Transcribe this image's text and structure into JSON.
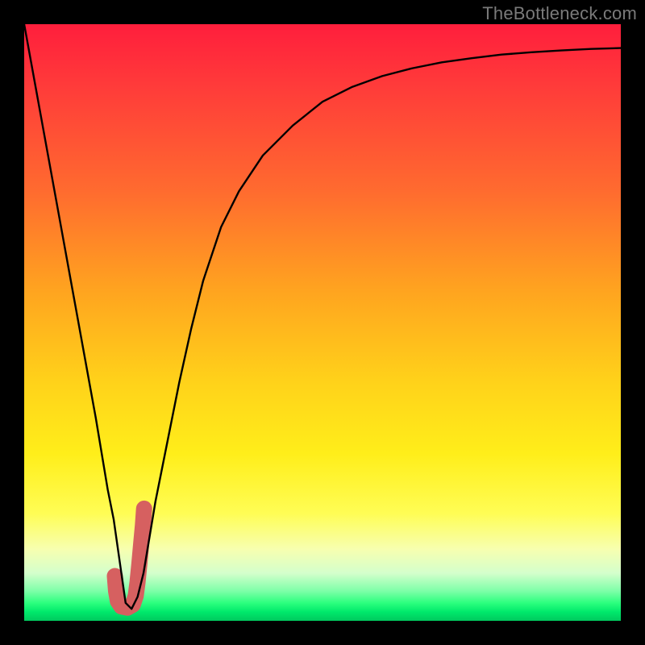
{
  "watermark": "TheBottleneck.com",
  "chart_data": {
    "type": "line",
    "title": "",
    "xlabel": "",
    "ylabel": "",
    "xlim": [
      0,
      100
    ],
    "ylim": [
      0,
      100
    ],
    "description": "Bottleneck percentage curve over a red-to-green vertical gradient background; minimum near x≈17.",
    "x": [
      0,
      2,
      4,
      6,
      8,
      10,
      12,
      14,
      15,
      16,
      17,
      18,
      19,
      20,
      21,
      22,
      24,
      26,
      28,
      30,
      33,
      36,
      40,
      45,
      50,
      55,
      60,
      65,
      70,
      75,
      80,
      85,
      90,
      95,
      100
    ],
    "values": [
      100,
      89,
      78,
      67,
      56,
      45,
      34,
      22,
      17,
      10,
      3,
      2,
      4,
      8,
      14,
      20,
      30,
      40,
      49,
      57,
      66,
      72,
      78,
      83,
      87,
      89.5,
      91.3,
      92.6,
      93.6,
      94.3,
      94.9,
      95.3,
      95.6,
      95.85,
      96
    ],
    "marker": {
      "note": "thick salmon J-shaped stroke near the curve minimum",
      "x": [
        15.2,
        15.4,
        15.7,
        16.3,
        17.3,
        18.2,
        18.7,
        19.0,
        19.3,
        19.6,
        19.9,
        20.1
      ],
      "y": [
        7.5,
        5.0,
        3.3,
        2.4,
        2.2,
        2.7,
        4.2,
        6.5,
        9.5,
        12.8,
        16.0,
        18.8
      ],
      "color": "#d66060",
      "width": 20
    }
  }
}
